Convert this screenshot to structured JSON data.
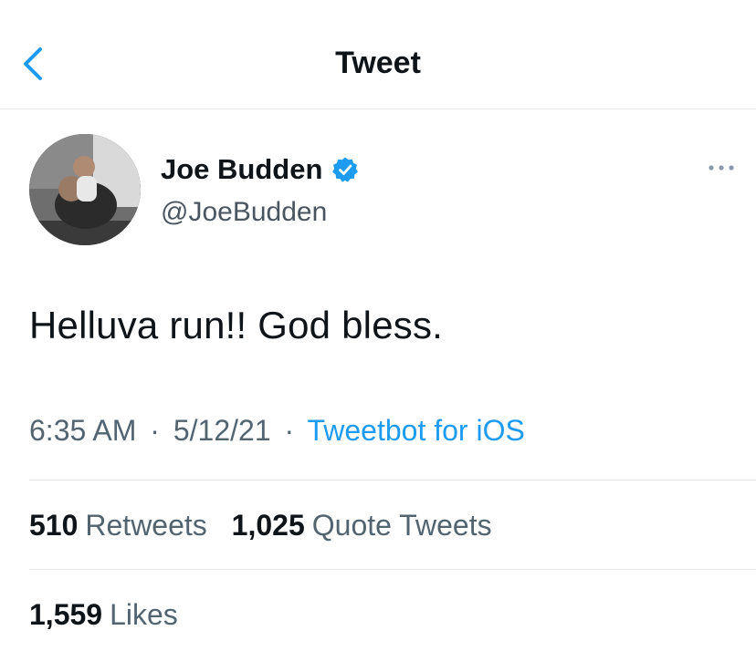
{
  "header": {
    "title": "Tweet",
    "back_icon": "chevron-left-icon"
  },
  "author": {
    "name": "Joe Budden",
    "handle": "@JoeBudden",
    "verified": true,
    "verified_icon": "verified-badge-icon"
  },
  "more_icon": "ellipsis-icon",
  "tweet": {
    "text": "Helluva run!! God bless."
  },
  "meta": {
    "time": "6:35 AM",
    "separator": "·",
    "date": "5/12/21",
    "source": "Tweetbot for iOS"
  },
  "stats": {
    "retweets_count": "510",
    "retweets_label": "Retweets",
    "quotes_count": "1,025",
    "quotes_label": "Quote Tweets",
    "likes_count": "1,559",
    "likes_label": "Likes"
  },
  "colors": {
    "accent": "#1d9bf0",
    "text_primary": "#0f1419",
    "text_secondary": "#536471",
    "divider": "#e4e7ea"
  }
}
